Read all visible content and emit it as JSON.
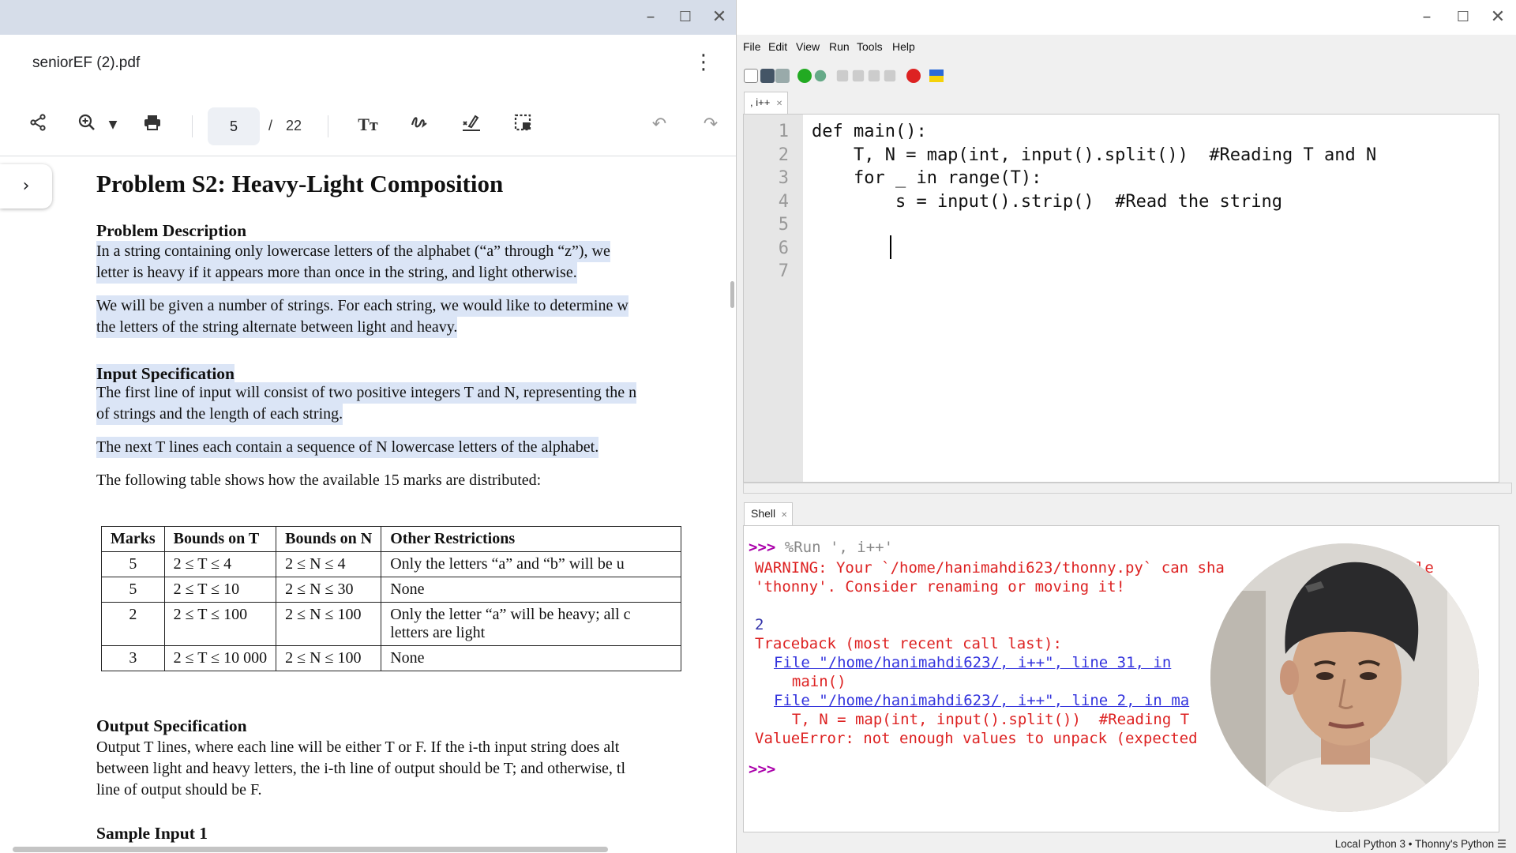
{
  "pdf_viewer": {
    "file_name": "seniorEF (2).pdf",
    "current_page": "5",
    "page_separator": "/",
    "total_pages": "22",
    "document": {
      "title": "Problem S2: Heavy-Light Composition",
      "sections": {
        "description_heading": "Problem Description",
        "desc_p1_line1": "In a string containing only lowercase letters of the alphabet (“a” through “z”), we",
        "desc_p1_line2": "letter is heavy if it appears more than once in the string, and light otherwise.",
        "desc_p2_line1": "We will be given a number of strings. For each string, we would like to determine w",
        "desc_p2_line2": "the letters of the string alternate between light and heavy.",
        "input_heading": "Input Specification",
        "input_p1_line1": "The first line of input will consist of two positive integers T and N, representing the n",
        "input_p1_line2": "of strings and the length of each string.",
        "input_p2": "The next T lines each contain a sequence of N lowercase letters of the alphabet.",
        "marks_intro": "The following table shows how the available 15 marks are distributed:",
        "output_heading": "Output Specification",
        "output_line1": "Output T lines, where each line will be either T or F. If the i-th input string does alt",
        "output_line2": "between light and heavy letters, the i-th line of output should be T; and otherwise, tl",
        "output_line3": "line of output should be F.",
        "sample_heading": "Sample Input 1"
      },
      "marks_table": {
        "headers": [
          "Marks",
          "Bounds on T",
          "Bounds on N",
          "Other Restrictions"
        ],
        "rows": [
          [
            "5",
            "2 ≤ T ≤ 4",
            "2 ≤ N ≤ 4",
            "Only the letters “a” and “b” will be u"
          ],
          [
            "5",
            "2 ≤ T ≤ 10",
            "2 ≤ N ≤ 30",
            "None"
          ],
          [
            "2",
            "2 ≤ T ≤ 100",
            "2 ≤ N ≤ 100",
            "Only the letter “a” will be heavy; all c"
          ],
          [
            "3",
            "2 ≤ T ≤ 10 000",
            "2 ≤ N ≤ 100",
            "None"
          ]
        ],
        "row3_extra": "letters are light"
      }
    }
  },
  "thonny": {
    "menu": [
      "File",
      "Edit",
      "View",
      "Run",
      "Tools",
      "Help"
    ],
    "editor_tab": ", i++",
    "shell_tab": "Shell",
    "code_lines": [
      {
        "num": "1",
        "text": "def main():"
      },
      {
        "num": "2",
        "text": "    T, N = map(int, input().split())  #Reading T and N"
      },
      {
        "num": "3",
        "text": "    for _ in range(T):"
      },
      {
        "num": "4",
        "text": "        s = input().strip()  #Read the string"
      },
      {
        "num": "5",
        "text": ""
      },
      {
        "num": "6",
        "text": ""
      },
      {
        "num": "7",
        "text": ""
      }
    ],
    "shell": {
      "prompt": ">>>",
      "run_command": "%Run ', i++'",
      "warning_line1": "WARNING: Your `/home/hanimahdi623/thonny.py` can sha",
      "warning_line1_tail": "dule",
      "warning_line2": "'thonny'. Consider renaming or moving it!",
      "input_echo": "2",
      "traceback_header": "Traceback (most recent call last):",
      "tb_file1": "File \"/home/hanimahdi623/, i++\", line 31, in",
      "tb_code1": "  main()",
      "tb_file2": "File \"/home/hanimahdi623/, i++\", line 2, in ma",
      "tb_code2": "  T, N = map(int, input().split())  #Reading T",
      "error": "ValueError: not enough values to unpack (expected"
    },
    "status_bar": "Local Python 3  •  Thonny's Python  ☰"
  }
}
